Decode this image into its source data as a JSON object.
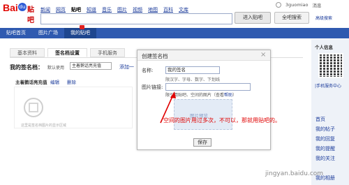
{
  "header": {
    "logo_text": "Bai",
    "logo_paw": "du",
    "logo_product": "贴吧",
    "nav_links": [
      "新闻",
      "网页",
      "贴吧",
      "知道",
      "音乐",
      "图片",
      "视频",
      "地图",
      "百科",
      "文库"
    ],
    "active_nav": "贴吧",
    "username": "3guomiao",
    "user_msg": "消息",
    "search_enter_label": "进入贴吧",
    "search_all_label": "全吧搜索",
    "adv_search": "高级搜索"
  },
  "main_nav": {
    "tabs": [
      "贴吧首页",
      "图片广场",
      "我的贴吧"
    ],
    "active": "我的贴吧"
  },
  "page": {
    "tabs": [
      "基本资料",
      "签名档设置",
      "手机服务"
    ],
    "active_tab": "签名档设置",
    "my_sig_label": "我的签名档：",
    "default_use": "默认使用",
    "select_value": "主着鹅话亮充值",
    "add_link": "添加一",
    "item_title": "主着鹅话亮充值",
    "edit": "编辑",
    "delete": "删除",
    "preview_caption": "这里是签名档图片的显示区域"
  },
  "modal": {
    "title": "创建签名档",
    "close": "×",
    "name_label": "名称:",
    "name_value": "我的签名",
    "hint": "限汉字、字母、数字、下划线",
    "link_label": "图片链接:",
    "link_value": "",
    "note_prefix": "限引用贴吧、空间的图片（查看",
    "note_help": "帮助",
    "note_suffix": "）",
    "img_preview": "图片预览",
    "save_label": "保存"
  },
  "annotation": {
    "text": "空间的图片用过多次，不可以，那就用贴吧的。",
    "color": "#e00000"
  },
  "right_col": {
    "heading": "个人信息",
    "phone_service": "|手机服务中心",
    "items": [
      "首页",
      "我的帖子",
      "我的回复",
      "我的提醒",
      "我的关注",
      "我的相册"
    ]
  },
  "watermark": "jingyan.baidu.com"
}
